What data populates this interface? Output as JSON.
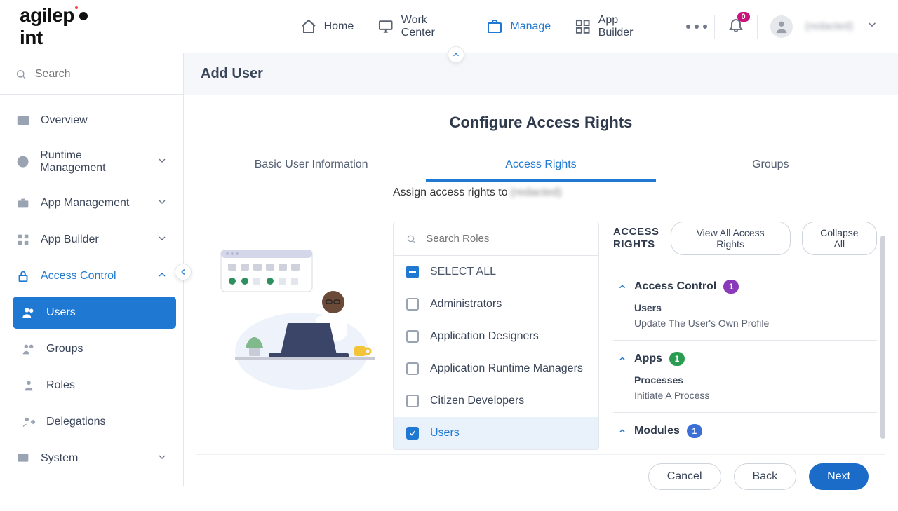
{
  "header": {
    "nav": {
      "home": "Home",
      "work_center": "Work Center",
      "manage": "Manage",
      "app_builder": "App Builder"
    },
    "notification_count": "0",
    "username": "(redacted)"
  },
  "sidebar": {
    "search_placeholder": "Search",
    "items": {
      "overview": "Overview",
      "runtime_mgmt": "Runtime Management",
      "app_mgmt": "App Management",
      "app_builder": "App Builder",
      "access_control": "Access Control",
      "users": "Users",
      "groups": "Groups",
      "roles": "Roles",
      "delegations": "Delegations",
      "system": "System"
    }
  },
  "page": {
    "title": "Add User",
    "panel_title": "Configure Access Rights",
    "tabs": {
      "basic": "Basic User Information",
      "rights": "Access Rights",
      "groups": "Groups"
    },
    "assign_prefix": "Assign access rights to",
    "assign_user": "(redacted)",
    "roles": {
      "search_placeholder": "Search Roles",
      "select_all": "SELECT ALL",
      "administrators": "Administrators",
      "app_designers": "Application Designers",
      "runtime_managers": "Application Runtime Managers",
      "citizen_devs": "Citizen Developers",
      "users": "Users"
    },
    "rights": {
      "heading": "ACCESS RIGHTS",
      "view_all": "View All Access Rights",
      "collapse_all": "Collapse All",
      "groups": [
        {
          "name": "Access Control",
          "count": "1",
          "color": "purple",
          "items": [
            {
              "title": "Users",
              "desc": "Update The User's Own Profile"
            }
          ]
        },
        {
          "name": "Apps",
          "count": "1",
          "color": "green",
          "items": [
            {
              "title": "Processes",
              "desc": "Initiate A Process"
            }
          ]
        },
        {
          "name": "Modules",
          "count": "1",
          "color": "blue",
          "items": []
        }
      ]
    },
    "footer": {
      "cancel": "Cancel",
      "back": "Back",
      "next": "Next"
    }
  }
}
